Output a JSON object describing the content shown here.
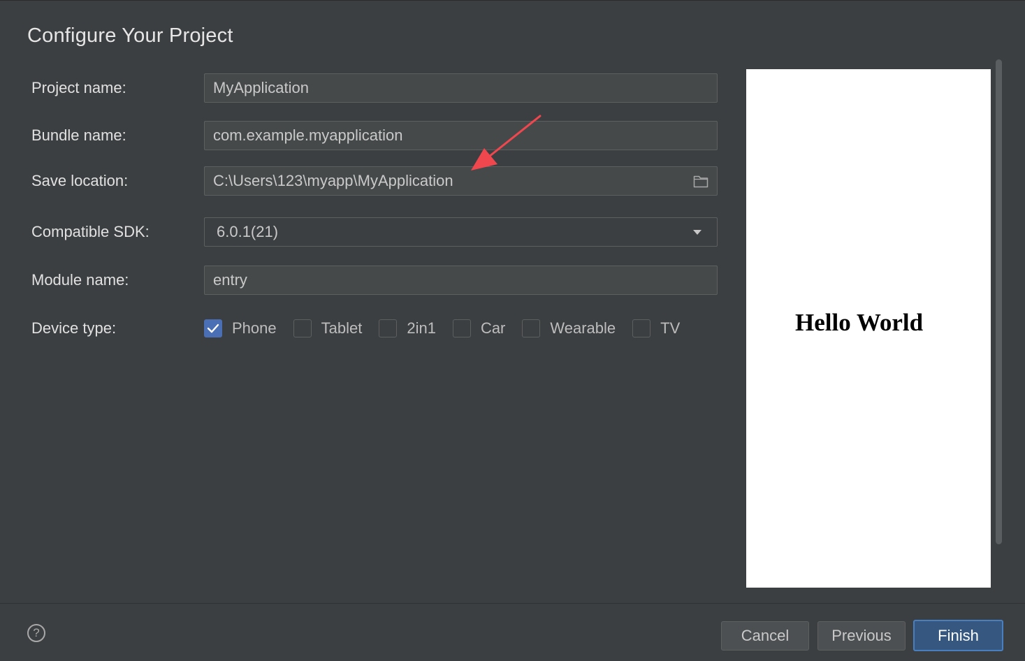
{
  "dialog": {
    "title": "Configure Your Project"
  },
  "form": {
    "project_name": {
      "label": "Project name:",
      "value": "MyApplication"
    },
    "bundle_name": {
      "label": "Bundle name:",
      "value": "com.example.myapplication"
    },
    "save_location": {
      "label": "Save location:",
      "value": "C:\\Users\\123\\myapp\\MyApplication",
      "icon": "folder-icon"
    },
    "compatible_sdk": {
      "label": "Compatible SDK:",
      "value": "6.0.1(21)",
      "icon": "chevron-down-icon"
    },
    "module_name": {
      "label": "Module name:",
      "value": "entry"
    },
    "device_type": {
      "label": "Device type:",
      "options": [
        {
          "label": "Phone",
          "checked": true
        },
        {
          "label": "Tablet",
          "checked": false
        },
        {
          "label": "2in1",
          "checked": false
        },
        {
          "label": "Car",
          "checked": false
        },
        {
          "label": "Wearable",
          "checked": false
        },
        {
          "label": "TV",
          "checked": false
        }
      ]
    }
  },
  "preview": {
    "text": "Hello World"
  },
  "footer": {
    "help_icon": "?",
    "cancel_label": "Cancel",
    "previous_label": "Previous",
    "finish_label": "Finish"
  },
  "colors": {
    "background": "#3c3f41",
    "field": "#45494a",
    "accent": "#4a6fb5",
    "finish_button": "#365880",
    "annotation_arrow": "#f0474f"
  }
}
